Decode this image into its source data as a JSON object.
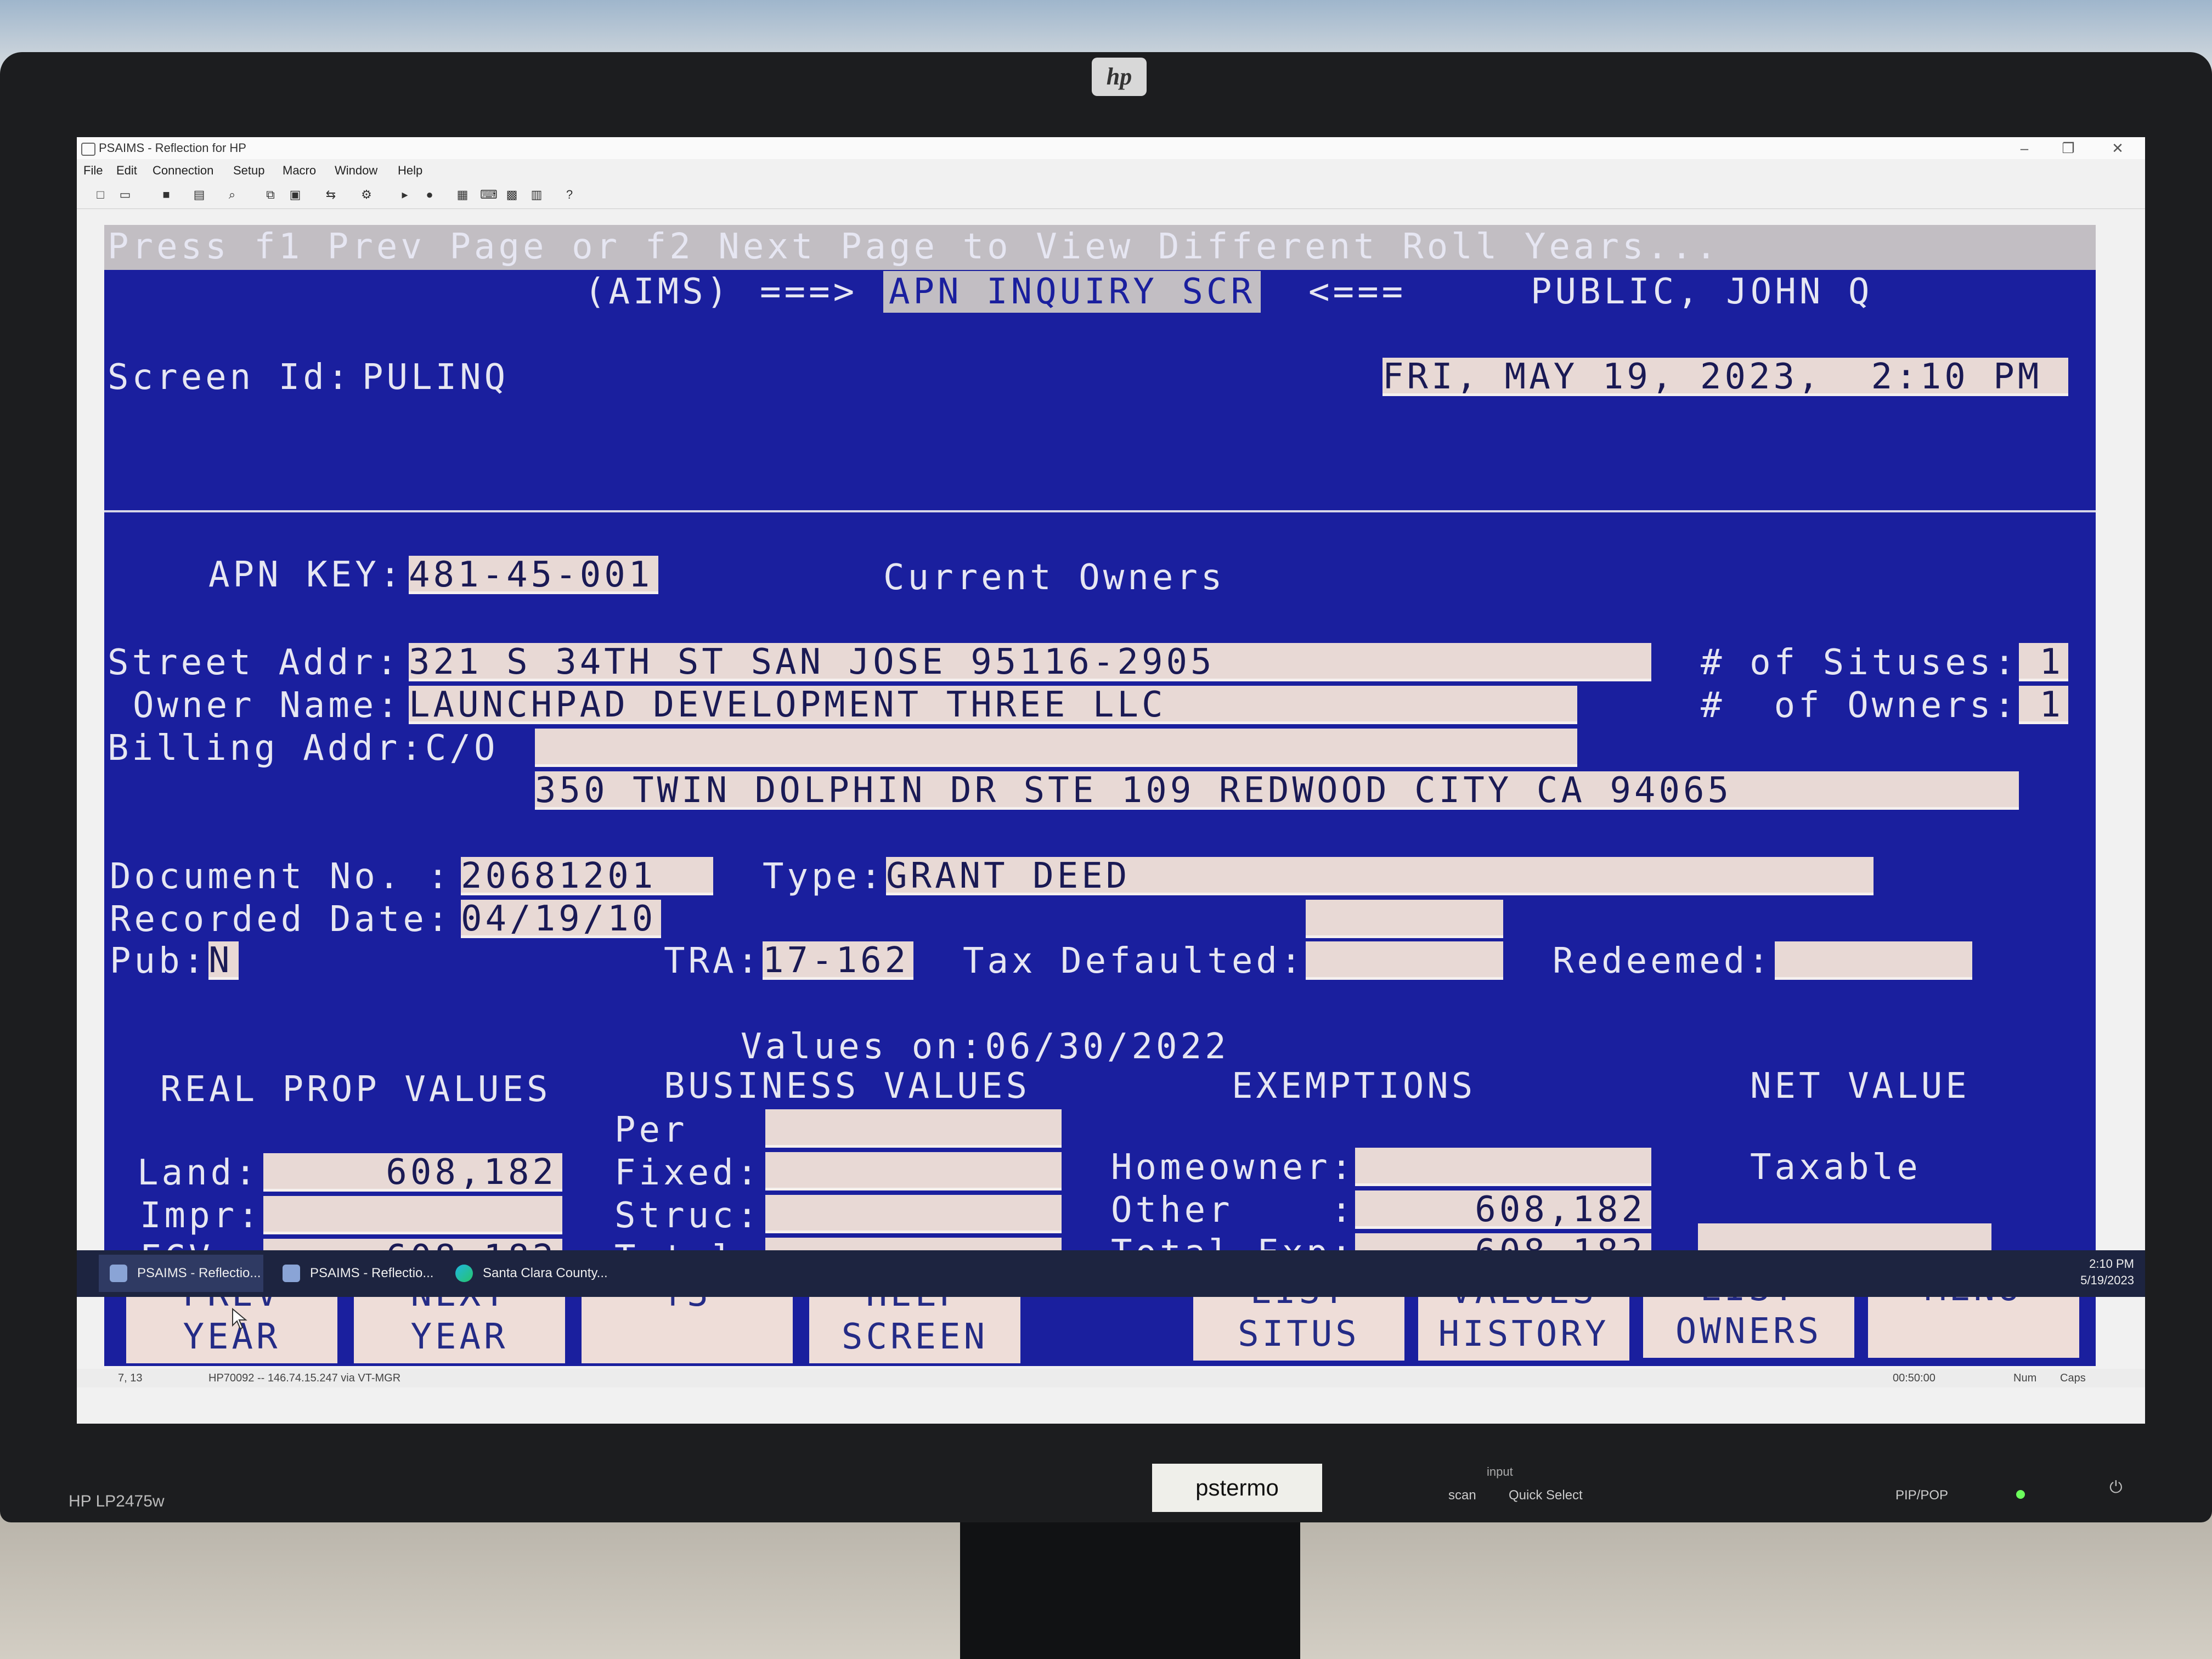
{
  "monitor": {
    "brand_logo": "hp",
    "model": "HP LP2475w",
    "name_label": "pstermo",
    "input_label": "input",
    "buttons": [
      "scan",
      "Quick Select",
      "PIP/POP"
    ]
  },
  "window": {
    "title": "PSAIMS - Reflection for HP",
    "menu": [
      "File",
      "Edit",
      "Connection",
      "Setup",
      "Macro",
      "Window",
      "Help"
    ],
    "toolbar_icons": [
      "new-file-icon",
      "open-icon",
      "save-icon",
      "print-icon",
      "find-icon",
      "copy-icon",
      "paste-icon",
      "transfer-icon",
      "settings-icon",
      "play-icon",
      "record-icon",
      "display-icon",
      "keyboard-icon",
      "mouse-icon",
      "colors-icon",
      "help-icon"
    ]
  },
  "terminal": {
    "message": "Press f1 Prev Page or f2 Next Page to View Different Roll Years...",
    "system": "(AIMS)",
    "arrow_right": "===>",
    "screen_name": "APN INQUIRY SCR",
    "arrow_left": "<===",
    "user": "PUBLIC, JOHN Q",
    "screen_id_label": "Screen Id:",
    "screen_id": "PULINQ",
    "datetime": "FRI, MAY 19, 2023,  2:10 PM",
    "apn_label": "APN KEY:",
    "apn": "481-45-001",
    "section_owners": "Current Owners",
    "street_label": "Street Addr:",
    "street": "321 S 34TH ST SAN JOSE 95116-2905",
    "situses_label": "# of Situses:",
    "situses": "1",
    "owner_label": "Owner Name:",
    "owner": "LAUNCHPAD DEVELOPMENT THREE LLC",
    "owners_label": "#  of Owners:",
    "owners": "1",
    "billing_label": "Billing Addr:C/O",
    "billing_co": "",
    "billing_addr": "350 TWIN DOLPHIN DR STE 109 REDWOOD CITY CA 94065",
    "doc_label": "Document No. :",
    "doc": "20681201",
    "type_label": "Type:",
    "type": "GRANT DEED",
    "recorded_label": "Recorded Date:",
    "recorded": "04/19/10",
    "pub_label": "Pub:",
    "pub": "N",
    "tra_label": "TRA:",
    "tra": "17-162",
    "tax_default_label": "Tax Defaulted:",
    "tax_default": "",
    "redeemed_label": "Redeemed:",
    "redeemed": "",
    "values_on": "Values on:06/30/2022",
    "hdr_real": "REAL PROP VALUES",
    "hdr_business": "BUSINESS VALUES",
    "hdr_exemptions": "EXEMPTIONS",
    "hdr_net": "NET VALUE",
    "land_label": "Land:",
    "land": "608,182",
    "impr_label": "Impr:",
    "impr": "",
    "fcv_label": "FCV :",
    "fcv": "608,182",
    "per_label": "Per   :",
    "per": "",
    "fixed_label": "Fixed:",
    "fixed": "",
    "struc_label": "Struc:",
    "struc": "",
    "total_label": "Total:",
    "total": "",
    "homeowner_label": "Homeowner:",
    "homeowner": "",
    "other_label": "Other    :",
    "other": "608,182",
    "total_exp_label": "Total Exp:",
    "total_exp": "608,182",
    "taxable_label": "Taxable",
    "taxable": "",
    "function_keys": [
      "PREV\nYEAR",
      "NEXT\nYEAR",
      "f3",
      "HELP\nSCREEN",
      "LIST\nSITUS",
      "VALUES\nHISTORY",
      "LIST\nOWNERS",
      "MENU"
    ]
  },
  "status": {
    "cursor": "7, 13",
    "host": "HP70092 -- 146.74.15.247 via VT-MGR",
    "timer": "00:50:00",
    "num": "Num",
    "caps": "Caps"
  },
  "taskbar": {
    "items": [
      "PSAIMS - Reflectio...",
      "PSAIMS - Reflectio...",
      "Santa Clara County..."
    ],
    "time": "2:10 PM",
    "date": "5/19/2023"
  }
}
